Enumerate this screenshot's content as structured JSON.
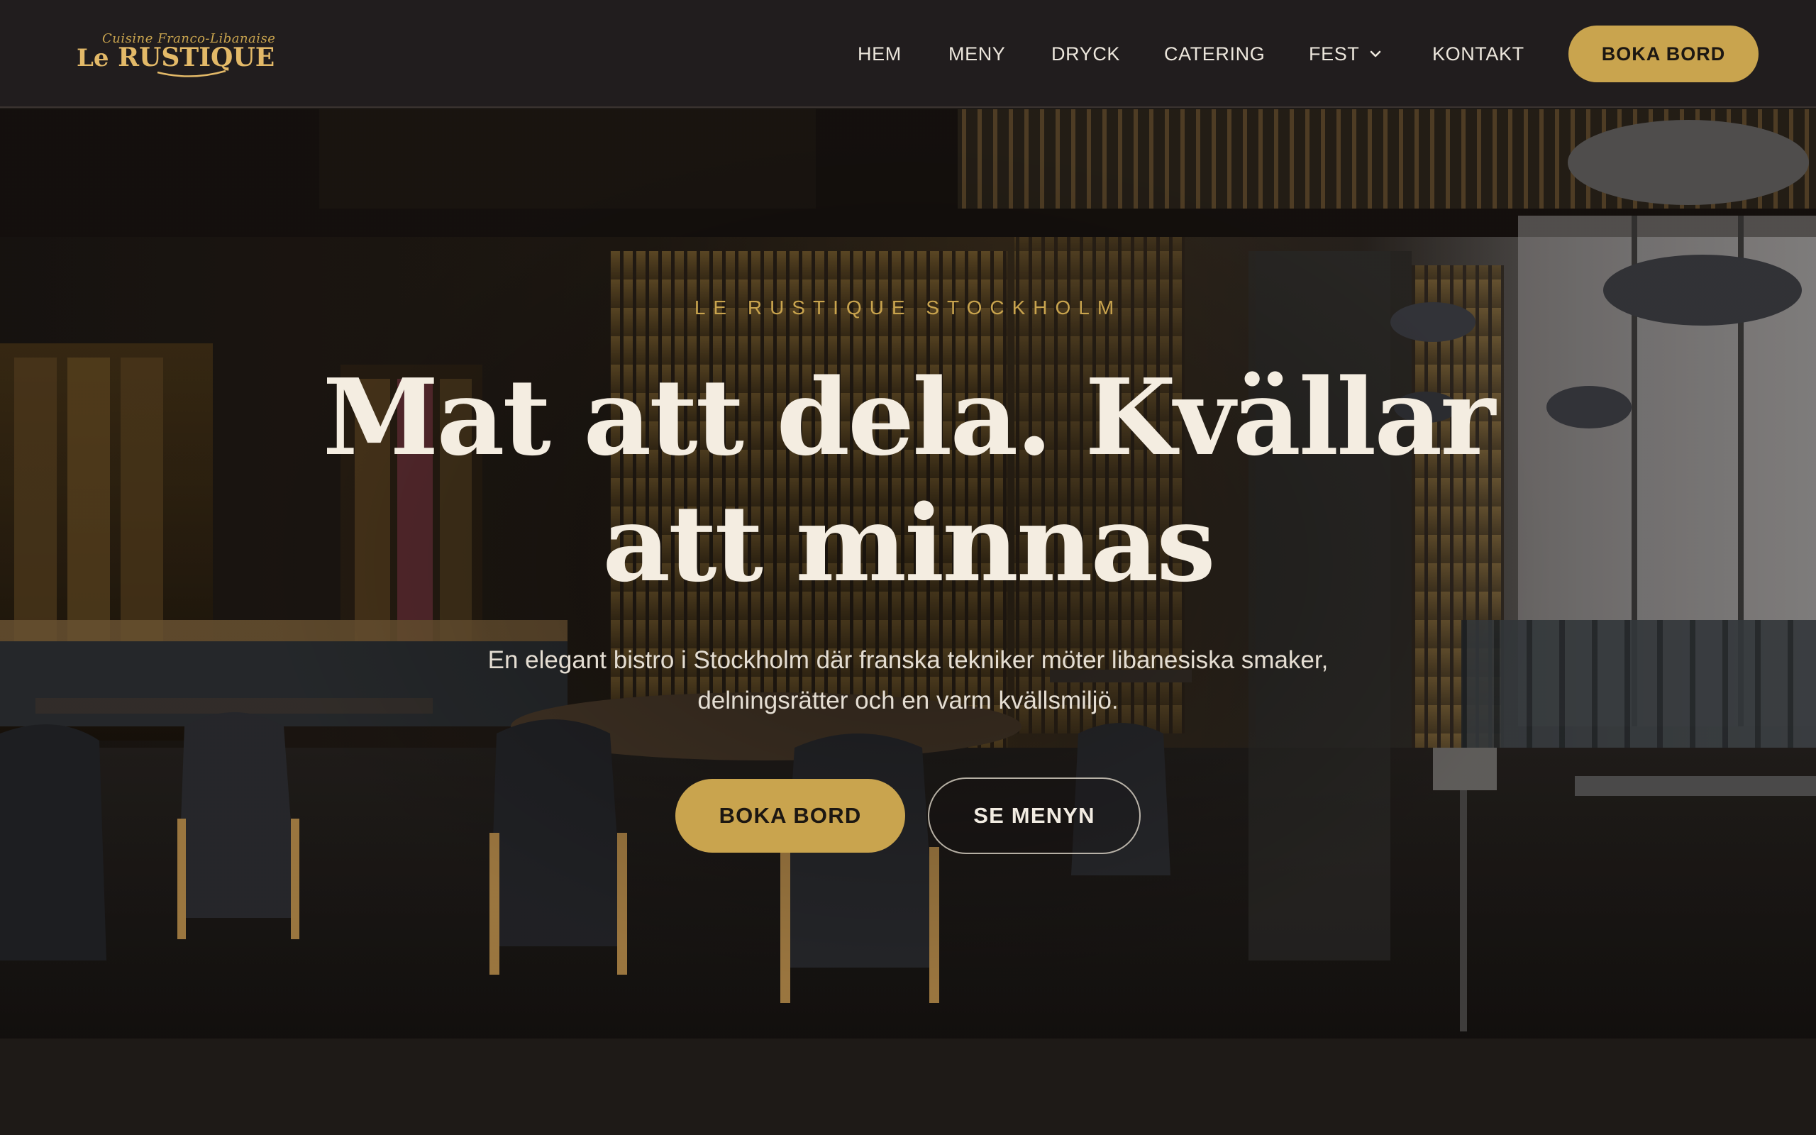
{
  "brand": {
    "tagline": "Cuisine Franco-Libanaise",
    "name_prefix": "Le",
    "name": "RUSTIQUE"
  },
  "nav": {
    "items": [
      {
        "label": "HEM"
      },
      {
        "label": "MENY"
      },
      {
        "label": "DRYCK"
      },
      {
        "label": "CATERING"
      },
      {
        "label": "FEST",
        "icon": "chevron-down-icon"
      },
      {
        "label": "KONTAKT"
      }
    ],
    "cta_label": "BOKA BORD"
  },
  "hero": {
    "eyebrow": "LE RUSTIQUE STOCKHOLM",
    "headline_line1": "Mat att dela. Kvällar",
    "headline_line2": "att minnas",
    "lead": "En elegant bistro i Stockholm där franska tekniker möter libanesiska smaker, delningsrätter och en varm kvällsmiljö.",
    "primary_cta": "BOKA BORD",
    "secondary_cta": "SE MENYN",
    "background": "restaurant-interior-photo"
  },
  "colors": {
    "accent_gold": "#c9a44e",
    "header_bg": "#211d1e",
    "page_bg": "#1e1a17",
    "headline": "#f4ede1"
  }
}
